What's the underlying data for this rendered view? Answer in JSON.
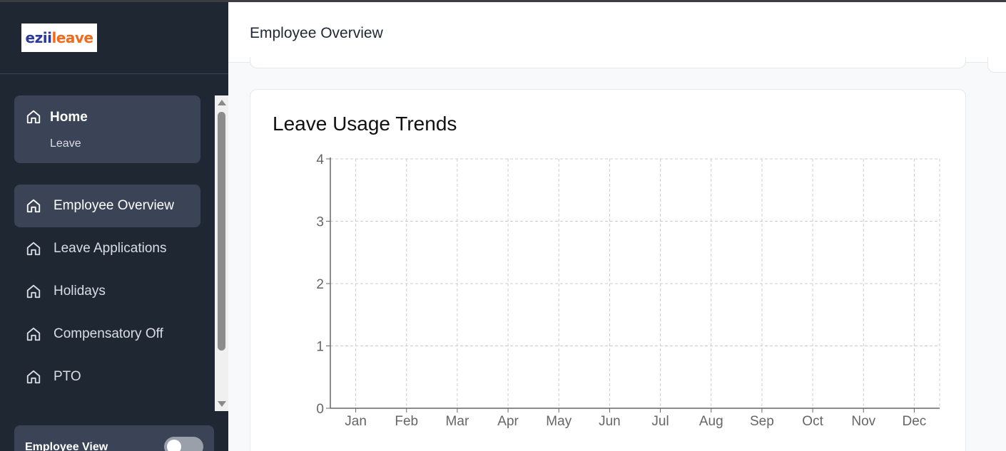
{
  "app": {
    "logo": {
      "part1": "ezii",
      "part2": "leave",
      "colors": {
        "part1": "#2b3a9a",
        "part2": "#f26a1b"
      }
    }
  },
  "sidebar": {
    "home": {
      "title": "Home",
      "subtitle": "Leave",
      "icon": "home-icon"
    },
    "items": [
      {
        "label": "Employee Overview",
        "icon": "home-icon",
        "active": true
      },
      {
        "label": "Leave Applications",
        "icon": "home-icon",
        "active": false
      },
      {
        "label": "Holidays",
        "icon": "home-icon",
        "active": false
      },
      {
        "label": "Compensatory Off",
        "icon": "home-icon",
        "active": false
      },
      {
        "label": "PTO",
        "icon": "home-icon",
        "active": false
      }
    ],
    "view_toggle": {
      "label": "Employee View",
      "on": false
    }
  },
  "header": {
    "title": "Employee Overview"
  },
  "colors": {
    "sidebar_bg": "#1f2733",
    "active_bg": "#3b4456",
    "grid": "#cccccc",
    "axis": "#666666"
  },
  "chart_data": {
    "type": "line",
    "title": "Leave Usage Trends",
    "categories": [
      "Jan",
      "Feb",
      "Mar",
      "Apr",
      "May",
      "Jun",
      "Jul",
      "Aug",
      "Sep",
      "Oct",
      "Nov",
      "Dec"
    ],
    "series": [],
    "ylim": [
      0,
      4
    ],
    "yticks": [
      0,
      1,
      2,
      3,
      4
    ],
    "grid": true,
    "grid_style": "dashed",
    "xlabel": "",
    "ylabel": ""
  }
}
